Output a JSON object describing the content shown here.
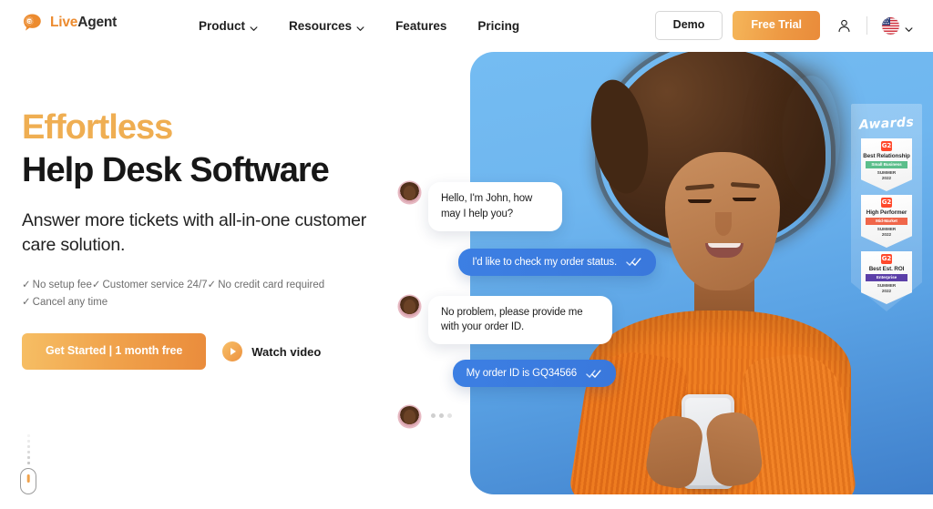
{
  "brand": {
    "logo_live": "Live",
    "logo_agent": "Agent",
    "logo_icon": "speech-bubble-at-icon",
    "accent_orange": "#EFAE52",
    "accent_orange_deep": "#EA8C3C",
    "chat_blue": "#3C7FE3",
    "hero_bg_blue": "#74BCF2"
  },
  "nav": {
    "items": [
      {
        "label": "Product",
        "has_dropdown": true
      },
      {
        "label": "Resources",
        "has_dropdown": true
      },
      {
        "label": "Features",
        "has_dropdown": false
      },
      {
        "label": "Pricing",
        "has_dropdown": false
      }
    ],
    "demo_label": "Demo",
    "trial_label": "Free Trial",
    "account_icon": "user-icon",
    "language_flag": "us-flag-icon",
    "language_chevron": "chevron-down-icon"
  },
  "hero": {
    "headline_accent": "Effortless",
    "headline_main": "Help Desk Software",
    "subheadline": "Answer more tickets with all-in-one customer care solution.",
    "features": [
      "No setup fee",
      "Customer service 24/7",
      "No credit card required",
      "Cancel any time"
    ],
    "tick": "✓",
    "primary_cta": "Get Started | 1 month free",
    "watch_label": "Watch video",
    "play_icon": "play-icon",
    "scroll_icon": "scroll-down-mouse-icon"
  },
  "chat": {
    "messages": [
      {
        "from": "agent",
        "text": "Hello, I'm John, how may I help you?",
        "read": false
      },
      {
        "from": "customer",
        "text": "I'd like to check my order status.",
        "read": true
      },
      {
        "from": "agent",
        "text": "No problem, please provide me with your order ID.",
        "read": false
      },
      {
        "from": "customer",
        "text": "My order ID is GQ34566",
        "read": true
      },
      {
        "from": "agent",
        "text": "",
        "typing": true
      }
    ],
    "read_icon": "double-check-icon",
    "avatar_name": "agent-avatar"
  },
  "awards": {
    "title": "Awards",
    "badges": [
      {
        "title": "Best Relationship",
        "category": "Small Business",
        "category_color": "#5BBE8B",
        "season": "SUMMER",
        "year": "2022",
        "logo": "G2"
      },
      {
        "title": "High Performer",
        "category": "Mid-Market",
        "category_color": "#F0664A",
        "season": "SUMMER",
        "year": "2022",
        "logo": "G2"
      },
      {
        "title": "Best Est. ROI",
        "category": "Enterprise",
        "category_color": "#5B3FA8",
        "season": "SUMMER",
        "year": "2022",
        "logo": "G2"
      }
    ]
  }
}
